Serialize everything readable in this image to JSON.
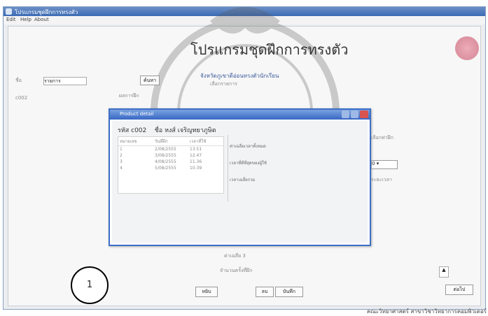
{
  "window": {
    "title": "โปรแกรมชุดฝึกการทรงตัว"
  },
  "menu": [
    "Edit",
    "Help",
    "About"
  ],
  "main": {
    "title": "โปรแกรมชุดฝึกการทรงตัว",
    "subtitle_blue": "จังหวัดภูเขาดีอ่อนทรงตัวนักเรียน",
    "subtitle_gray": "เลือกรายการ",
    "find_button": "ค้นหา",
    "tab_label": "รายการ",
    "left_labels": [
      "ชื่อ",
      "c002"
    ],
    "col_header_small": "ผลการฝึก"
  },
  "dialog": {
    "title": "Product detail",
    "header_code": "รหัส c002",
    "header_name": "ชื่อ  หงส์   เจริญทยาภูษิต",
    "grid_headers": [
      "หมายเลข",
      "วันที่ฝึก",
      "เวลาที่ใช้"
    ],
    "grid_rows": [
      [
        "1",
        "2/08/2555",
        "13.51"
      ],
      [
        "2",
        "3/08/2555",
        "12.47"
      ],
      [
        "3",
        "4/08/2555",
        "11.36"
      ],
      [
        "4",
        "5/08/2555",
        "10.39"
      ]
    ],
    "right_labels": [
      "ค่าเฉลี่ยเวลาทั้งหมด",
      "เวลาที่ดีที่สุดของผู้ใช้",
      "เวลาเฉลี่ยรวม"
    ]
  },
  "below_dialog": {
    "line1": "ค่าเฉลี่ย 3",
    "line2": "จำนวนครั้งที่ฝึก"
  },
  "buttons": {
    "b1": "หยิบ",
    "b2": "ลบ",
    "b3": "บันทึก",
    "b4": "ต่อไป"
  },
  "right_panel": {
    "label_top": "เลือกท่าฝึก",
    "combo_value": "0",
    "label_mid": "ระยะเวลา"
  },
  "annotation": {
    "number": "1"
  },
  "footer": {
    "text": "คณะวิทยาศาสตร์ สาขาวิชาวิทยาการคอมพิวเตอร์"
  },
  "colors": {
    "titlebar": "#3b6bb5",
    "dialog_border": "#3c6fc6",
    "close": "#d9534f"
  }
}
